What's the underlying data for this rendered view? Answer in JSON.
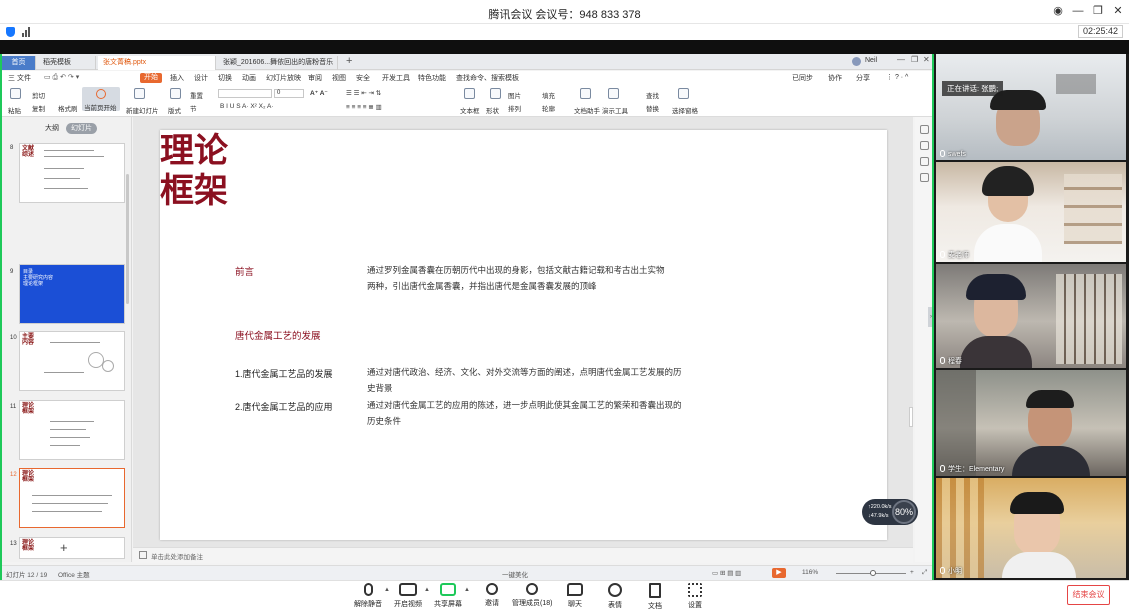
{
  "meeting": {
    "title": "腾讯会议  会议号：948 833 378",
    "timer": "02:25:42",
    "end_button": "结束会议"
  },
  "wps": {
    "tabs": [
      {
        "label": "首页"
      },
      {
        "label": "稻壳模板"
      },
      {
        "label": "张文菁稿.pptx"
      },
      {
        "label": "张颖_201606...舞依回出的唐粉音乐"
      }
    ],
    "user": "Neil",
    "menus": [
      "三 文件",
      "开始",
      "插入",
      "设计",
      "切换",
      "动画",
      "幻灯片放映",
      "审阅",
      "视图",
      "安全",
      "开发工具",
      "特色功能",
      "查找命令、搜索模板"
    ],
    "menu_right": [
      "已同步",
      "协作",
      "分享"
    ],
    "ribbon": {
      "paste": "粘贴",
      "cut": "剪切",
      "copy": "复制",
      "format_painter": "格式刷",
      "current_cursor": "当前页开始",
      "new_slide": "新建幻灯片",
      "layout": "版式",
      "section": "节",
      "reset": "重置",
      "font_size": "0",
      "textbox": "文本框",
      "shape": "形状",
      "arrange": "排列",
      "picture": "图片",
      "fill": "填充",
      "outline": "轮廓",
      "doc_helper": "文档助手",
      "presenter_tools": "演示工具",
      "find": "查找",
      "replace": "替换",
      "select_pane": "选择窗格"
    },
    "panel_tabs": [
      "大纲",
      "幻灯片"
    ],
    "thumbs": [
      {
        "num": "8",
        "title": "文献\n综述"
      },
      {
        "num": "9",
        "title": "目录\n主要研究内容\n理论框架"
      },
      {
        "num": "10",
        "title": "主要\n内容"
      },
      {
        "num": "11",
        "title": "理论\n框架"
      },
      {
        "num": "12",
        "title": "理论\n框架"
      },
      {
        "num": "13",
        "title": "理论\n框架"
      }
    ],
    "slide": {
      "title_line1": "理论",
      "title_line2": "框架",
      "sections": [
        {
          "label": "前言",
          "text1": "通过罗列金属香囊在历朝历代中出现的身影，包括文献古籍记载和考古出土实物",
          "text2": "两种，引出唐代金属香囊，并指出唐代是金属香囊发展的顶峰"
        },
        {
          "label": "唐代金属工艺的发展"
        },
        {
          "label": "1.唐代金属工艺品的发展",
          "text1": "通过对唐代政治、经济、文化、对外交流等方面的阐述，点明唐代金属工艺发展的历",
          "text2": "史背景"
        },
        {
          "label": "2.唐代金属工艺品的应用",
          "text1": "通过对唐代金属工艺的应用的陈述，进一步点明此使其金属工艺的繁荣和香囊出现的",
          "text2": "历史条件"
        }
      ]
    },
    "notes_placeholder": "单击此处添加备注",
    "status": {
      "slide_count": "幻灯片 12 / 19",
      "theme": "Office 主题",
      "beautify": "一键美化",
      "zoom": "116%"
    },
    "network": {
      "up": "↑220.0k/s",
      "down": "↓47.9k/s",
      "percent": "80%"
    }
  },
  "videos": {
    "speaker_label": "正在讲话: 张鹏;",
    "participants": [
      {
        "name": "swefs"
      },
      {
        "name": "麦老师"
      },
      {
        "name": "程春"
      },
      {
        "name": "学生：Elementary"
      },
      {
        "name": "小明"
      }
    ]
  },
  "toolbar": [
    {
      "label": "解除静音"
    },
    {
      "label": "开启视频"
    },
    {
      "label": "共享屏幕"
    },
    {
      "label": "邀请"
    },
    {
      "label": "管理成员(18)"
    },
    {
      "label": "聊天"
    },
    {
      "label": "表情"
    },
    {
      "label": "文档"
    },
    {
      "label": "设置"
    }
  ],
  "colors": {
    "accent": "#e8682f",
    "slide_title": "#8b1020",
    "green_border": "#1ec95a",
    "end_red": "#e54545"
  }
}
